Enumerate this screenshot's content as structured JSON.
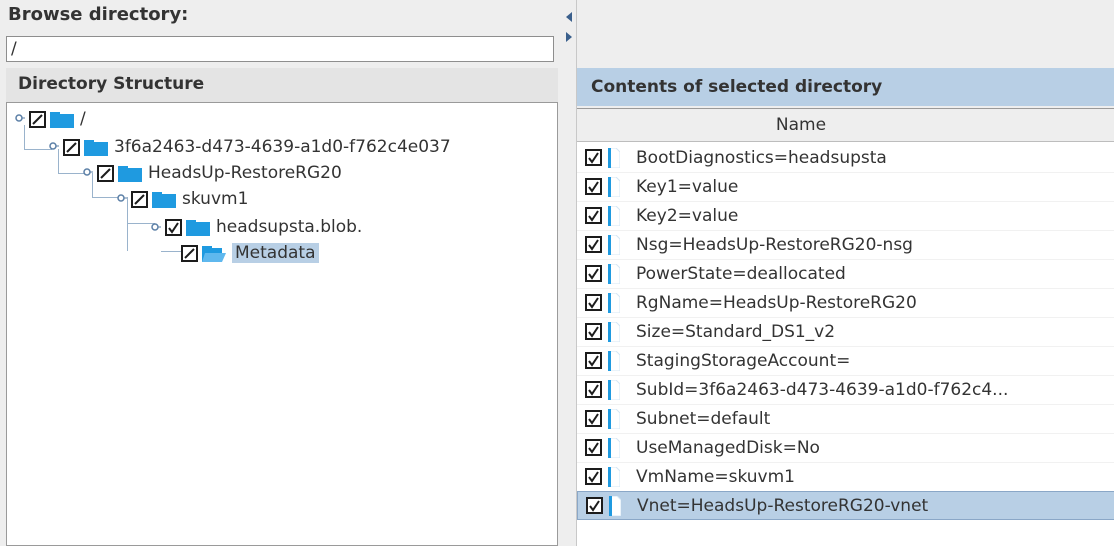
{
  "browse": {
    "label": "Browse directory:",
    "path_value": "/"
  },
  "directory_structure": {
    "header": "Directory Structure",
    "nodes": [
      {
        "label": "/",
        "checked": "partial",
        "icon": "folder-icon"
      },
      {
        "label": "3f6a2463-d473-4639-a1d0-f762c4e037",
        "checked": "partial",
        "icon": "folder-icon"
      },
      {
        "label": "HeadsUp-RestoreRG20",
        "checked": "partial",
        "icon": "folder-icon"
      },
      {
        "label": "skuvm1",
        "checked": "partial",
        "icon": "folder-icon"
      },
      {
        "label": "headsupsta.blob.",
        "checked": "checked",
        "icon": "folder-icon"
      },
      {
        "label": "Metadata",
        "checked": "partial",
        "icon": "folder-open-icon",
        "selected": true
      }
    ]
  },
  "contents": {
    "header": "Contents of selected directory",
    "column_name": "Name",
    "rows": [
      {
        "name": "BootDiagnostics=headsupsta"
      },
      {
        "name": "Key1=value"
      },
      {
        "name": "Key2=value"
      },
      {
        "name": "Nsg=HeadsUp-RestoreRG20-nsg"
      },
      {
        "name": "PowerState=deallocated"
      },
      {
        "name": "RgName=HeadsUp-RestoreRG20"
      },
      {
        "name": "Size=Standard_DS1_v2"
      },
      {
        "name": "StagingStorageAccount="
      },
      {
        "name": "SubId=3f6a2463-d473-4639-a1d0-f762c4..."
      },
      {
        "name": "Subnet=default"
      },
      {
        "name": "UseManagedDisk=No"
      },
      {
        "name": "VmName=skuvm1"
      },
      {
        "name": "Vnet=HeadsUp-RestoreRG20-vnet",
        "selected": true
      }
    ]
  },
  "colors": {
    "selection": "#b8cfe5",
    "folder": "#1f9ae0",
    "pane_bg": "#eeeeee"
  }
}
